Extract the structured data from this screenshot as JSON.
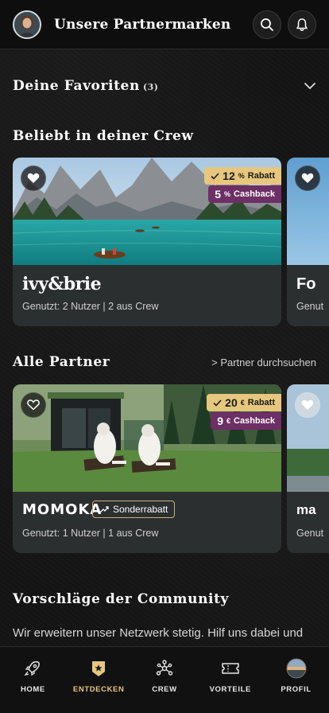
{
  "header": {
    "title": "Unsere Partnermarken",
    "avatar_icon": "user-avatar",
    "search_icon": "search-icon",
    "bell_icon": "bell-icon"
  },
  "favorites": {
    "title": "Deine Favoriten",
    "count": "(3)"
  },
  "crew_section": {
    "title": "Beliebt in deiner Crew",
    "cards": [
      {
        "brand": "ivy&brie",
        "discount_value": "12",
        "discount_unit": "%",
        "discount_label": "Rabatt",
        "cashback_value": "5",
        "cashback_unit": "%",
        "cashback_label": "Cashback",
        "usage": "Genutzt: 2 Nutzer | 2 aus Crew"
      }
    ],
    "peek": {
      "brand": "Fo",
      "usage": "Genut"
    }
  },
  "partners_section": {
    "title": "Alle Partner",
    "search_link": "> Partner durchsuchen",
    "cards": [
      {
        "brand": "MOMOKA",
        "tag": "Sonderrabatt",
        "discount_value": "20",
        "discount_unit": "€",
        "discount_label": "Rabatt",
        "cashback_value": "9",
        "cashback_unit": "€",
        "cashback_label": "Cashback",
        "usage": "Genutzt: 1 Nutzer | 1 aus Crew"
      }
    ],
    "peek": {
      "brand": "ma",
      "usage": "Genut"
    }
  },
  "community": {
    "title": "Vorschläge der Community",
    "text": "Wir erweitern unser Netzwerk stetig. Hilf uns dabei und"
  },
  "nav": {
    "items": [
      {
        "label": "HOME",
        "icon": "rocket-icon"
      },
      {
        "label": "ENTDECKEN",
        "icon": "star-badge-icon"
      },
      {
        "label": "CREW",
        "icon": "network-icon"
      },
      {
        "label": "VORTEILE",
        "icon": "ticket-icon"
      },
      {
        "label": "PROFIL",
        "icon": "profile-picture"
      }
    ],
    "active": "ENTDECKEN"
  },
  "colors": {
    "accent_gold": "#e6c77d",
    "cashback_purple": "#6d2f66",
    "card_bg": "#2c2f30",
    "page_bg": "#141414"
  }
}
